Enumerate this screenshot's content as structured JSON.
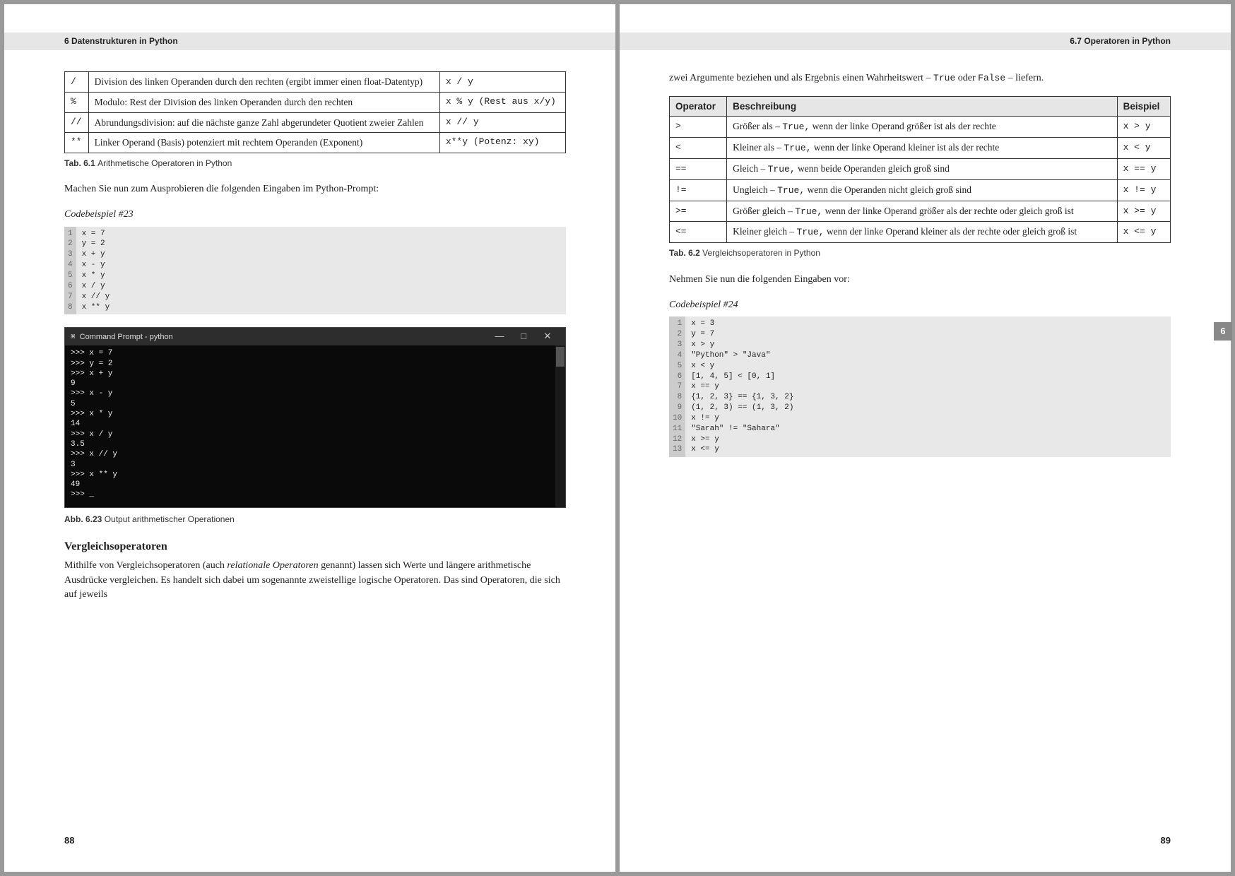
{
  "left": {
    "running_head": "6   Datenstrukturen in Python",
    "page_number": "88",
    "table1": {
      "rows": [
        {
          "op": "/",
          "desc": "Division des linken Operanden durch den rechten (ergibt immer einen float-Datentyp)",
          "ex": "x / y"
        },
        {
          "op": "%",
          "desc": "Modulo: Rest der Division des linken Operanden durch den rechten",
          "ex": "x % y (Rest aus x/y)"
        },
        {
          "op": "//",
          "desc": "Abrundungsdivision: auf die nächste ganze Zahl abgerundeter Quotient zweier Zahlen",
          "ex": "x // y"
        },
        {
          "op": "**",
          "desc": "Linker Operand (Basis) potenziert mit rechtem Operanden (Exponent)",
          "ex": "x**y (Potenz: xy)"
        }
      ]
    },
    "caption1_b": "Tab. 6.1",
    "caption1_t": "Arithmetische Operatoren in Python",
    "para1": "Machen Sie nun zum Ausprobieren die folgenden Eingaben im Python-Prompt:",
    "code23_title": "Codebeispiel #23",
    "code23_lines": "1\n2\n3\n4\n5\n6\n7\n8",
    "code23_body": "x = 7\ny = 2\nx + y\nx - y\nx * y\nx / y\nx // y\nx ** y",
    "term_title": "Command Prompt - python",
    "term_min": "—",
    "term_max": "□",
    "term_close": "✕",
    "term_body": ">>> x = 7\n>>> y = 2\n>>> x + y\n9\n>>> x - y\n5\n>>> x * y\n14\n>>> x / y\n3.5\n>>> x // y\n3\n>>> x ** y\n49\n>>> _",
    "caption2_b": "Abb. 6.23",
    "caption2_t": "Output arithmetischer Operationen",
    "h3": "Vergleichsoperatoren",
    "para2_pre": "Mithilfe von Vergleichsoperatoren (auch ",
    "para2_em": "relationale Operatoren",
    "para2_post": " genannt) lassen sich Werte und längere arithmetische Ausdrücke vergleichen. Es handelt sich dabei um sogenannte zweistellige logische Operatoren. Das sind Operatoren, die sich auf jeweils"
  },
  "right": {
    "running_head": "6.7   Operatoren in Python",
    "page_number": "89",
    "para1_pre": "zwei Argumente beziehen und als Ergebnis einen Wahrheitswert – ",
    "para1_m1": "True",
    "para1_mid": " oder ",
    "para1_m2": "False",
    "para1_post": " – liefern.",
    "table2": {
      "head": {
        "c1": "Operator",
        "c2": "Beschreibung",
        "c3": "Beispiel"
      },
      "rows": [
        {
          "op": ">",
          "desc_pre": "Größer als – ",
          "desc_code": "True,",
          "desc_post": " wenn der linke Operand größer ist als der rechte",
          "ex": "x > y"
        },
        {
          "op": "<",
          "desc_pre": "Kleiner als – ",
          "desc_code": "True,",
          "desc_post": " wenn der linke Operand kleiner ist als der rechte",
          "ex": "x < y"
        },
        {
          "op": "==",
          "desc_pre": "Gleich – ",
          "desc_code": "True,",
          "desc_post": " wenn beide Operanden gleich groß sind",
          "ex": "x == y"
        },
        {
          "op": "!=",
          "desc_pre": "Ungleich – ",
          "desc_code": "True,",
          "desc_post": " wenn die Operanden nicht gleich groß sind",
          "ex": "x != y"
        },
        {
          "op": ">=",
          "desc_pre": "Größer gleich – ",
          "desc_code": "True,",
          "desc_post": " wenn der linke Operand größer als der rechte oder gleich groß ist",
          "ex": "x >= y"
        },
        {
          "op": "<=",
          "desc_pre": "Kleiner gleich – ",
          "desc_code": "True,",
          "desc_post": " wenn der linke Operand kleiner als der rechte oder gleich groß ist",
          "ex": "x <= y"
        }
      ]
    },
    "caption3_b": "Tab. 6.2",
    "caption3_t": "Vergleichsoperatoren in Python",
    "para2": "Nehmen Sie nun die folgenden Eingaben vor:",
    "code24_title": "Codebeispiel #24",
    "code24_lines": "1\n2\n3\n4\n5\n6\n7\n8\n9\n10\n11\n12\n13",
    "code24_body": "x = 3\ny = 7\nx > y\n\"Python\" > \"Java\"\nx < y\n[1, 4, 5] < [0, 1]\nx == y\n{1, 2, 3} == {1, 3, 2}\n(1, 2, 3) == (1, 3, 2)\nx != y\n\"Sarah\" != \"Sahara\"\nx >= y\nx <= y",
    "thumb": "6"
  }
}
